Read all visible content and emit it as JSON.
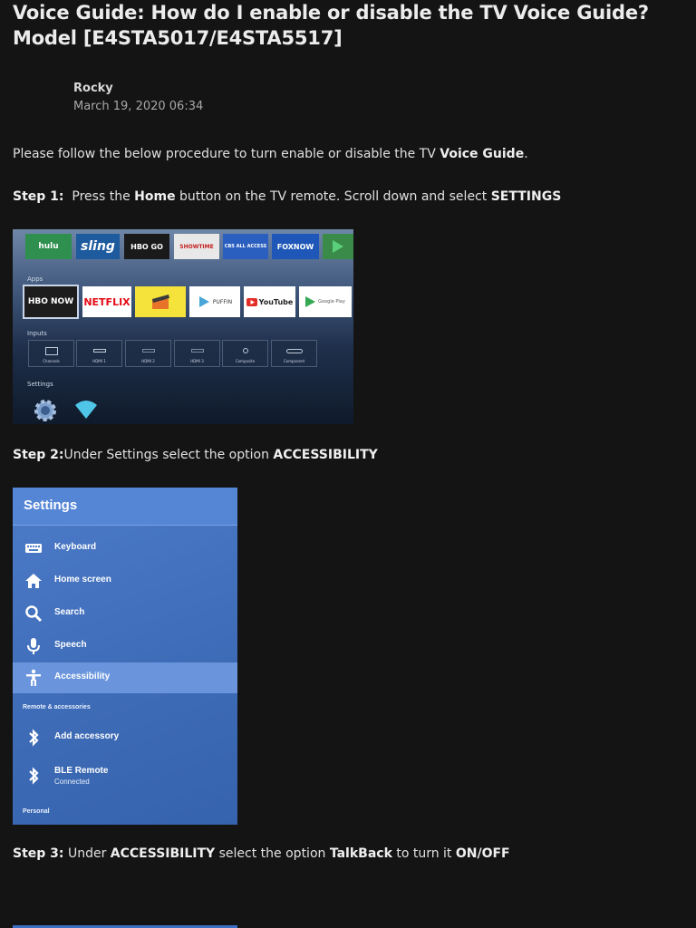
{
  "article": {
    "title": "Voice Guide: How do I enable or disable the TV Voice Guide? Model [E4STA5017/E4STA5517]",
    "author": "Rocky",
    "date": "March 19, 2020 06:34",
    "intro": {
      "pre": "Please follow the below procedure to turn enable or disable the TV ",
      "bold": "Voice Guide",
      "post": "."
    },
    "step1": {
      "label": "Step 1:",
      "t1": "  Press the ",
      "b1": "Home",
      "t2": " button on the TV remote. Scroll down and select ",
      "b2": "SETTINGS"
    },
    "step2": {
      "label": "Step 2:",
      "t1": "Under Settings select the option ",
      "b1": "ACCESSIBILITY"
    },
    "step3": {
      "label": "Step 3:",
      "t1": " Under ",
      "b1": "ACCESSIBILITY",
      "t2": " select the option ",
      "b2": "TalkBack",
      "t3": " to turn it ",
      "b3": "ON/OFF"
    }
  },
  "tv_home": {
    "channels": [
      "hulu",
      "sling",
      "HBO GO",
      "SHOWTIME",
      "CBS ALL ACCESS",
      "FOXNOW"
    ],
    "apps_label": "Apps",
    "apps": [
      "HBO NOW",
      "NETFLIX",
      "",
      "PUFFIN",
      "YouTube",
      "Google Play"
    ],
    "inputs_label": "Inputs",
    "inputs": [
      "Channels",
      "HDMI 1",
      "HDMI 2",
      "HDMI 3",
      "Composite",
      "Component"
    ],
    "settings_label": "Settings",
    "colors": {
      "hulu": "#2e8f4e",
      "sling": "#1d5a9e",
      "hbogo": "#1a1a1a",
      "showtime": "#e8e8e8",
      "cbs": "#2a5fc0",
      "foxnow": "#1e57b8",
      "netflix": "#ffffff",
      "youtube": "#ffffff"
    }
  },
  "settings_screen": {
    "header": "Settings",
    "items": [
      {
        "label": "Keyboard",
        "icon": "keyboard-icon"
      },
      {
        "label": "Home screen",
        "icon": "home-icon"
      },
      {
        "label": "Search",
        "icon": "search-icon"
      },
      {
        "label": "Speech",
        "icon": "mic-icon"
      },
      {
        "label": "Accessibility",
        "icon": "accessibility-icon",
        "selected": true
      }
    ],
    "section_remote": "Remote & accessories",
    "remote_items": [
      {
        "label": "Add accessory",
        "icon": "bluetooth-icon"
      },
      {
        "label": "BLE Remote",
        "sub": "Connected",
        "icon": "bluetooth-icon"
      }
    ],
    "section_personal": "Personal"
  }
}
